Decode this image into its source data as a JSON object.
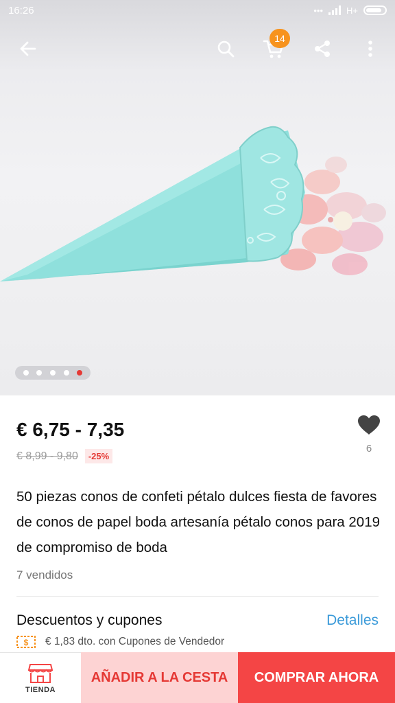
{
  "status_bar": {
    "time": "16:26",
    "network": "H+"
  },
  "top_bar": {
    "back_icon": "arrow-left-icon",
    "search_icon": "search-icon",
    "cart_icon": "cart-icon",
    "cart_count": "14",
    "share_icon": "share-icon",
    "more_icon": "more-vertical-icon"
  },
  "gallery": {
    "total_images": 5,
    "active_index": 5
  },
  "product": {
    "price": "€ 6,75 - 7,35",
    "original_price": "€ 8,99 - 9,80",
    "discount": "-25%",
    "wishlist_count": "6",
    "title": "50 piezas conos de confeti pétalo dulces fiesta de favores de conos de papel boda artesanía pétalo conos para 2019 de compromiso de boda",
    "sold": "7 vendidos"
  },
  "coupons": {
    "heading": "Descuentos y cupones",
    "details_link": "Detalles",
    "coupon_text": "€ 1,83 dto. con Cupones de Vendedor"
  },
  "bottom_bar": {
    "shop_label": "TIENDA",
    "add_to_cart": "AÑADIR A LA CESTA",
    "buy_now": "COMPRAR AHORA"
  },
  "colors": {
    "accent_red": "#f44545",
    "cart_button_bg": "#fdd3d3",
    "link_blue": "#3a9ad9",
    "badge_orange": "#f7931e",
    "cone_mint": "#8fe0dc"
  }
}
